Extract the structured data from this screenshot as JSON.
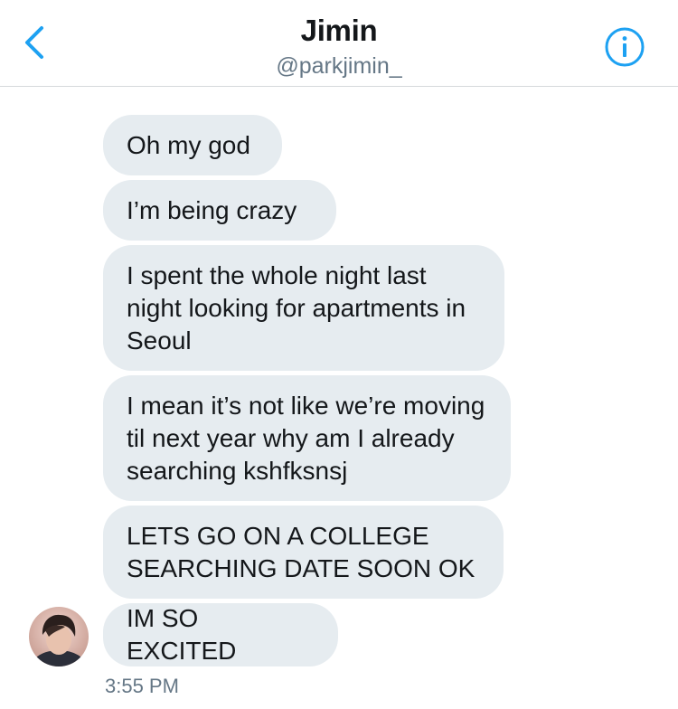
{
  "header": {
    "title": "Jimin",
    "handle": "@parkjimin_",
    "back_icon": "chevron-left-icon",
    "info_icon": "info-circle-icon",
    "accent_color": "#1da1f2"
  },
  "messages": [
    {
      "text": "Oh my god"
    },
    {
      "text": "I’m being crazy"
    },
    {
      "text": "I spent the whole night last night looking for apartments in Seoul"
    },
    {
      "text": "I mean it’s not like we’re moving til next year why am I already searching kshfksnsj"
    },
    {
      "text": "LETS GO ON A COLLEGE SEARCHING DATE SOON OK"
    },
    {
      "text": "IM SO EXCITED"
    }
  ],
  "timestamp": "3:55 PM",
  "colors": {
    "bubble_bg": "#e6ecf0",
    "text": "#14171a",
    "secondary_text": "#657786"
  }
}
